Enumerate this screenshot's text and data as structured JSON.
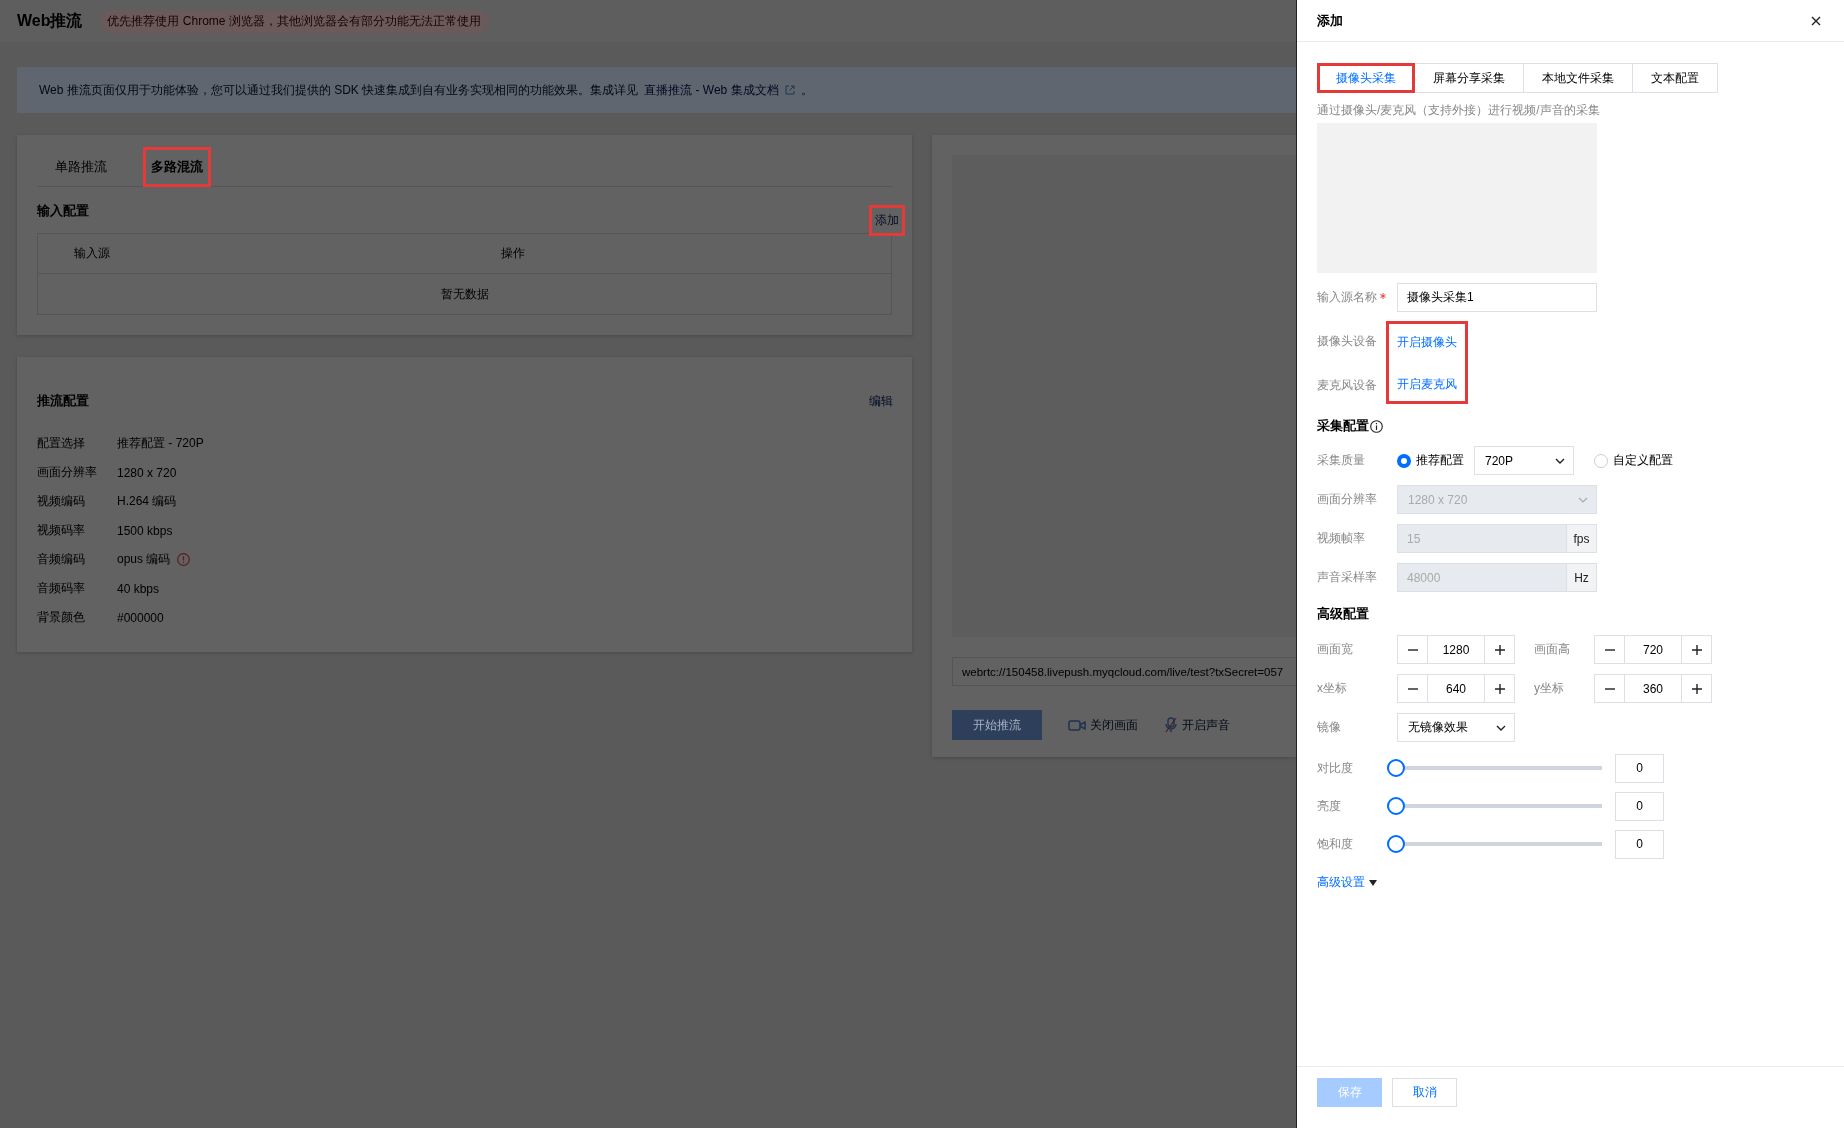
{
  "header": {
    "title": "Web推流",
    "notice": "优先推荐使用 Chrome 浏览器，其他浏览器会有部分功能无法正常使用"
  },
  "info_banner": {
    "text": "Web 推流页面仅用于功能体验，您可以通过我们提供的 SDK 快速集成到自有业务实现相同的功能效果。集成详见",
    "link": "直播推流 - Web 集成文档",
    "tail": "。"
  },
  "mode_tabs": [
    {
      "label": "单路推流",
      "selected": false,
      "highlighted": false
    },
    {
      "label": "多路混流",
      "selected": true,
      "highlighted": true
    }
  ],
  "input_config": {
    "title": "输入配置",
    "add_link": {
      "label": "添加",
      "highlighted": true
    },
    "table": {
      "columns": [
        "输入源",
        "操作"
      ],
      "empty_text": "暂无数据"
    }
  },
  "push_config": {
    "title": "推流配置",
    "edit_link": "编辑",
    "fields": [
      {
        "label": "配置选择",
        "value": "推荐配置 - 720P",
        "warning": false
      },
      {
        "label": "画面分辨率",
        "value": "1280 x 720",
        "warning": false
      },
      {
        "label": "视频编码",
        "value": "H.264 编码",
        "warning": false
      },
      {
        "label": "视频码率",
        "value": "1500 kbps",
        "warning": false
      },
      {
        "label": "音频编码",
        "value": "opus 编码",
        "warning": true
      },
      {
        "label": "音频码率",
        "value": "40 kbps",
        "warning": false
      },
      {
        "label": "背景颜色",
        "value": "#000000",
        "warning": false
      }
    ]
  },
  "preview": {
    "url": "webrtc://150458.livepush.myqcloud.com/live/test?txSecret=057",
    "start_button": "开始推流",
    "camera_button": "关闭画面",
    "audio_button": "开启声音"
  },
  "drawer": {
    "title": "添加",
    "tabs": [
      {
        "label": "摄像头采集",
        "selected": true,
        "highlighted": true
      },
      {
        "label": "屏幕分享采集",
        "selected": false,
        "highlighted": false
      },
      {
        "label": "本地文件采集",
        "selected": false,
        "highlighted": false
      },
      {
        "label": "文本配置",
        "selected": false,
        "highlighted": false
      }
    ],
    "hint": "通过摄像头/麦克风（支持外接）进行视频/声音的采集",
    "name_field": {
      "label": "输入源名称",
      "required": true,
      "value": "摄像头采集1"
    },
    "devices": {
      "highlighted": true,
      "items": [
        {
          "label": "摄像头设备",
          "action": "开启摄像头"
        },
        {
          "label": "麦克风设备",
          "action": "开启麦克风"
        }
      ]
    },
    "capture": {
      "title": "采集配置",
      "quality_label": "采集质量",
      "options": [
        {
          "label": "推荐配置",
          "selected": true,
          "select": "720P"
        },
        {
          "label": "自定义配置",
          "selected": false
        }
      ],
      "resolution": {
        "label": "画面分辨率",
        "value": "1280 x 720"
      },
      "fields": [
        {
          "label": "视频帧率",
          "value": "15",
          "unit": "fps"
        },
        {
          "label": "声音采样率",
          "value": "48000",
          "unit": "Hz"
        }
      ]
    },
    "advanced": {
      "title": "高级配置",
      "steppers": [
        {
          "label": "画面宽",
          "value": "1280"
        },
        {
          "label": "画面高",
          "value": "720"
        },
        {
          "label": "x坐标",
          "value": "640"
        },
        {
          "label": "y坐标",
          "value": "360"
        }
      ],
      "mirror": {
        "label": "镜像",
        "value": "无镜像效果"
      },
      "sliders": [
        {
          "label": "对比度",
          "level": 0,
          "value": "0"
        },
        {
          "label": "亮度",
          "level": 0,
          "value": "0"
        },
        {
          "label": "饱和度",
          "level": 0,
          "value": "0"
        }
      ],
      "more_link": "高级设置"
    },
    "buttons": [
      {
        "label": "保存",
        "kind": "primary",
        "disabled": true
      },
      {
        "label": "取消",
        "kind": "default",
        "disabled": false
      }
    ]
  }
}
